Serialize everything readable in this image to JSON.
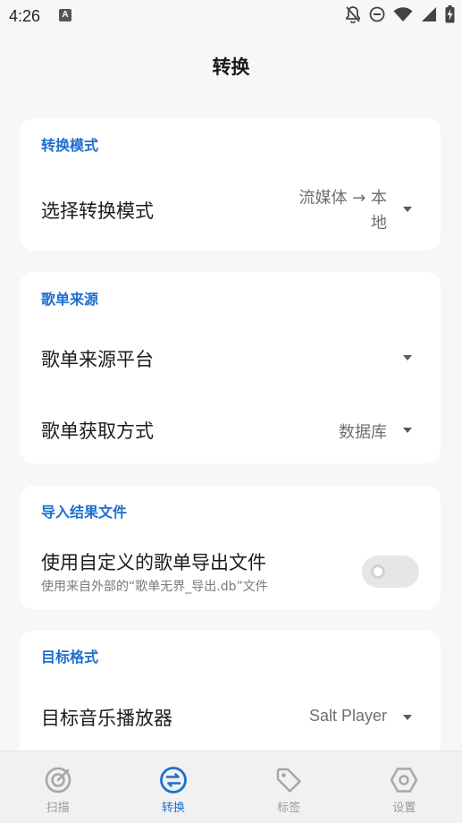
{
  "status": {
    "time": "4:26",
    "notification_icon": "A"
  },
  "page": {
    "title": "转换"
  },
  "sections": [
    {
      "title": "转换模式",
      "rows": [
        {
          "label": "选择转换模式",
          "value_line1": "流媒体 → 本",
          "value_line2": "地"
        }
      ]
    },
    {
      "title": "歌单来源",
      "rows": [
        {
          "label": "歌单来源平台",
          "value": ""
        },
        {
          "label": "歌单获取方式",
          "value": "数据库"
        }
      ]
    },
    {
      "title": "导入结果文件",
      "rows": [
        {
          "label": "使用自定义的歌单导出文件",
          "subtitle": "使用来自外部的“歌单无界_导出.db”文件",
          "toggle_on": false
        }
      ]
    },
    {
      "title": "目标格式",
      "rows": [
        {
          "label": "目标音乐播放器",
          "value": "Salt Player"
        }
      ]
    }
  ],
  "nav": {
    "items": [
      {
        "label": "扫描",
        "icon": "scan-icon",
        "active": false
      },
      {
        "label": "转换",
        "icon": "convert-icon",
        "active": true
      },
      {
        "label": "标签",
        "icon": "tag-icon",
        "active": false
      },
      {
        "label": "设置",
        "icon": "settings-icon",
        "active": false
      }
    ]
  },
  "colors": {
    "accent": "#1e6fd0",
    "background": "#f7f7f7",
    "card": "#ffffff",
    "nav_inactive": "#9a9a9a"
  }
}
